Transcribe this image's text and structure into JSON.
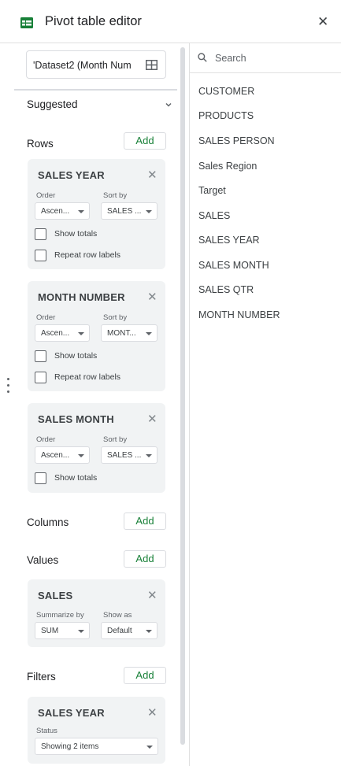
{
  "header": {
    "title": "Pivot table editor",
    "close_icon": "close-icon",
    "logo_icon": "pivot-table-icon",
    "accent": "#188038"
  },
  "range": {
    "value": "'Dataset2 (Month Num",
    "icon": "grid-select-icon"
  },
  "suggested": {
    "label": "Suggested",
    "icon": "chevron-down-icon"
  },
  "rows": {
    "label": "Rows",
    "add_label": "Add",
    "cards": [
      {
        "title": "SALES YEAR",
        "order_label": "Order",
        "order_value": "Ascen...",
        "sort_label": "Sort by",
        "sort_value": "SALES ...",
        "show_totals": "Show totals",
        "repeat_labels": "Repeat row labels"
      },
      {
        "title": "MONTH NUMBER",
        "order_label": "Order",
        "order_value": "Ascen...",
        "sort_label": "Sort by",
        "sort_value": "MONT...",
        "show_totals": "Show totals",
        "repeat_labels": "Repeat row labels"
      },
      {
        "title": "SALES MONTH",
        "order_label": "Order",
        "order_value": "Ascen...",
        "sort_label": "Sort by",
        "sort_value": "SALES ...",
        "show_totals": "Show totals"
      }
    ]
  },
  "columns": {
    "label": "Columns",
    "add_label": "Add"
  },
  "values": {
    "label": "Values",
    "add_label": "Add",
    "cards": [
      {
        "title": "SALES",
        "summarize_label": "Summarize by",
        "summarize_value": "SUM",
        "show_as_label": "Show as",
        "show_as_value": "Default"
      }
    ]
  },
  "filters": {
    "label": "Filters",
    "add_label": "Add",
    "cards": [
      {
        "title": "SALES YEAR",
        "status_label": "Status",
        "status_value": "Showing 2 items"
      }
    ]
  },
  "search": {
    "placeholder": "Search",
    "value": ""
  },
  "fields": [
    "CUSTOMER",
    "PRODUCTS",
    "SALES PERSON",
    "Sales Region",
    "Target",
    "SALES",
    "SALES YEAR",
    "SALES MONTH",
    "SALES QTR",
    "MONTH NUMBER"
  ]
}
